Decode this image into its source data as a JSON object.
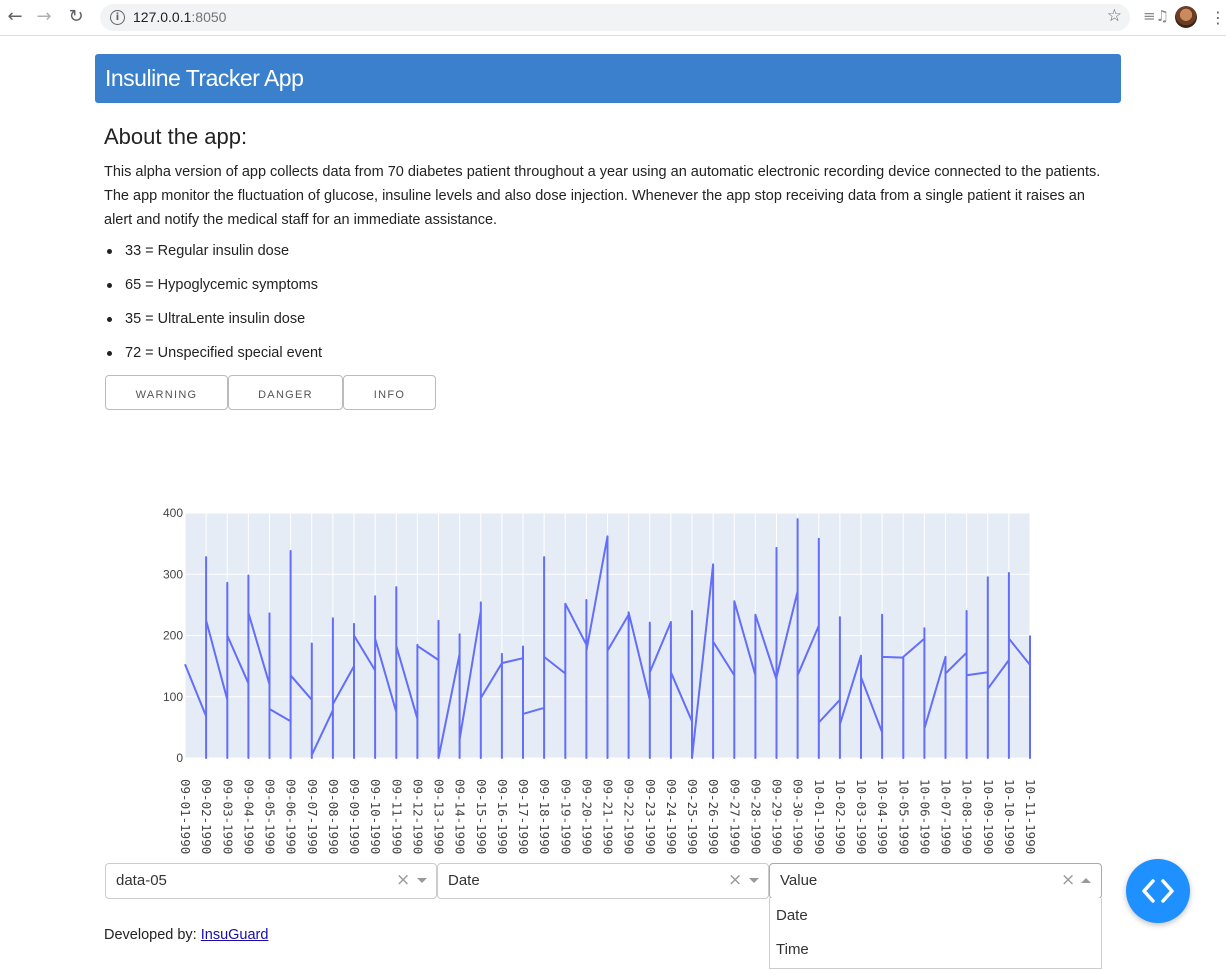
{
  "browser": {
    "url_host": "127.0.0.1",
    "url_port": ":8050"
  },
  "header": {
    "title": "Insuline Tracker App"
  },
  "about": {
    "title": "About the app:",
    "description": "This alpha version of app collects data from 70 diabetes patient throughout a year using an automatic electronic recording device connected to the patients. The app monitor the fluctuation of glucose, insuline levels and also dose injection. Whenever the app stop receiving data from a single patient it raises an alert and notify the medical staff for an immediate assistance.",
    "codes": [
      "33 = Regular insulin dose",
      "65 = Hypoglycemic symptoms",
      "35 = UltraLente insulin dose",
      "72 = Unspecified special event"
    ]
  },
  "buttons": {
    "warning": "WARNING",
    "danger": "DANGER",
    "info": "INFO"
  },
  "colors": {
    "header": "#3a80cc",
    "line": "#636efa",
    "plot_bg": "#e5ecf6",
    "fab": "#1e90ff"
  },
  "chart_data": {
    "type": "line",
    "ylim": [
      0,
      400
    ],
    "yticks": [
      0,
      100,
      200,
      300,
      400
    ],
    "xticks": [
      "09-01-1990",
      "09-02-1990",
      "09-03-1990",
      "09-04-1990",
      "09-05-1990",
      "09-06-1990",
      "09-07-1990",
      "09-08-1990",
      "09-09-1990",
      "09-10-1990",
      "09-11-1990",
      "09-12-1990",
      "09-13-1990",
      "09-14-1990",
      "09-15-1990",
      "09-16-1990",
      "09-17-1990",
      "09-18-1990",
      "09-19-1990",
      "09-20-1990",
      "09-21-1990",
      "09-22-1990",
      "09-23-1990",
      "09-24-1990",
      "09-25-1990",
      "09-26-1990",
      "09-27-1990",
      "09-28-1990",
      "09-29-1990",
      "09-30-1990",
      "10-01-1990",
      "10-02-1990",
      "10-03-1990",
      "10-04-1990",
      "10-05-1990",
      "10-06-1990",
      "10-07-1990",
      "10-08-1990",
      "10-09-1990",
      "10-10-1990",
      "10-11-1990"
    ],
    "series": [
      {
        "values": [
          [
            0,
            153
          ],
          [
            1,
            68
          ],
          [
            1,
            0
          ],
          [
            1,
            328
          ],
          [
            1,
            225
          ],
          [
            2,
            95
          ],
          [
            2,
            0
          ],
          [
            2,
            286
          ],
          [
            2,
            200
          ],
          [
            3,
            122
          ],
          [
            3,
            0
          ],
          [
            3,
            298
          ],
          [
            3,
            237
          ],
          [
            4,
            120
          ],
          [
            4,
            0
          ],
          [
            4,
            236
          ],
          [
            4,
            80
          ],
          [
            5,
            60
          ],
          [
            5,
            0
          ],
          [
            5,
            338
          ],
          [
            5,
            135
          ],
          [
            6,
            95
          ],
          [
            6,
            0
          ],
          [
            6,
            187
          ],
          [
            6,
            5
          ],
          [
            7,
            78
          ],
          [
            7,
            0
          ],
          [
            7,
            228
          ],
          [
            7,
            88
          ],
          [
            8,
            150
          ],
          [
            8,
            0
          ],
          [
            8,
            219
          ],
          [
            8,
            200
          ],
          [
            9,
            143
          ],
          [
            9,
            0
          ],
          [
            9,
            264
          ],
          [
            9,
            195
          ],
          [
            10,
            75
          ],
          [
            10,
            0
          ],
          [
            10,
            279
          ],
          [
            10,
            183
          ],
          [
            11,
            64
          ],
          [
            11,
            0
          ],
          [
            11,
            185
          ],
          [
            11,
            183
          ],
          [
            12,
            160
          ],
          [
            12,
            0
          ],
          [
            12,
            224
          ],
          [
            12,
            0
          ],
          [
            13,
            170
          ],
          [
            13,
            0
          ],
          [
            13,
            202
          ],
          [
            13,
            30
          ],
          [
            14,
            240
          ],
          [
            14,
            0
          ],
          [
            14,
            254
          ],
          [
            14,
            98
          ],
          [
            15,
            155
          ],
          [
            15,
            0
          ],
          [
            15,
            170
          ],
          [
            15,
            155
          ],
          [
            16,
            163
          ],
          [
            16,
            0
          ],
          [
            16,
            182
          ],
          [
            16,
            72
          ],
          [
            17,
            82
          ],
          [
            17,
            0
          ],
          [
            17,
            328
          ],
          [
            17,
            165
          ],
          [
            18,
            138
          ],
          [
            18,
            0
          ],
          [
            18,
            252
          ],
          [
            18,
            252
          ],
          [
            19,
            185
          ],
          [
            19,
            0
          ],
          [
            19,
            258
          ],
          [
            19,
            175
          ],
          [
            20,
            362
          ],
          [
            20,
            0
          ],
          [
            20,
            175
          ],
          [
            21,
            234
          ],
          [
            21,
            0
          ],
          [
            21,
            238
          ],
          [
            21,
            238
          ],
          [
            22,
            95
          ],
          [
            22,
            0
          ],
          [
            22,
            221
          ],
          [
            22,
            140
          ],
          [
            23,
            222
          ],
          [
            23,
            0
          ],
          [
            23,
            222
          ],
          [
            23,
            140
          ],
          [
            24,
            60
          ],
          [
            24,
            0
          ],
          [
            24,
            240
          ],
          [
            24,
            0
          ],
          [
            25,
            316
          ],
          [
            25,
            0
          ],
          [
            25,
            190
          ],
          [
            26,
            135
          ],
          [
            26,
            0
          ],
          [
            26,
            256
          ],
          [
            26,
            256
          ],
          [
            27,
            135
          ],
          [
            27,
            0
          ],
          [
            27,
            234
          ],
          [
            27,
            234
          ],
          [
            28,
            128
          ],
          [
            28,
            0
          ],
          [
            28,
            343
          ],
          [
            28,
            132
          ],
          [
            29,
            272
          ],
          [
            29,
            0
          ],
          [
            29,
            390
          ],
          [
            29,
            135
          ],
          [
            30,
            216
          ],
          [
            30,
            0
          ],
          [
            30,
            358
          ],
          [
            30,
            58
          ],
          [
            31,
            95
          ],
          [
            31,
            0
          ],
          [
            31,
            230
          ],
          [
            31,
            55
          ],
          [
            32,
            167
          ],
          [
            32,
            0
          ],
          [
            32,
            167
          ],
          [
            32,
            132
          ],
          [
            33,
            42
          ],
          [
            33,
            0
          ],
          [
            33,
            234
          ],
          [
            33,
            165
          ],
          [
            34,
            164
          ],
          [
            34,
            0
          ],
          [
            34,
            164
          ],
          [
            34,
            165
          ],
          [
            35,
            195
          ],
          [
            35,
            0
          ],
          [
            35,
            212
          ],
          [
            35,
            48
          ],
          [
            36,
            165
          ],
          [
            36,
            0
          ],
          [
            36,
            165
          ],
          [
            36,
            138
          ],
          [
            37,
            172
          ],
          [
            37,
            0
          ],
          [
            37,
            240
          ],
          [
            37,
            135
          ],
          [
            38,
            140
          ],
          [
            38,
            0
          ],
          [
            38,
            295
          ],
          [
            38,
            113
          ],
          [
            39,
            160
          ],
          [
            39,
            0
          ],
          [
            39,
            302
          ],
          [
            39,
            195
          ],
          [
            40,
            152
          ],
          [
            40,
            0
          ],
          [
            40,
            200
          ]
        ]
      }
    ]
  },
  "dropdowns": {
    "dataset": {
      "value": "data-05"
    },
    "x_axis": {
      "value": "Date"
    },
    "y_axis": {
      "value": "Value",
      "options": [
        "Date",
        "Time"
      ]
    }
  },
  "footer": {
    "label": "Developed by: ",
    "link": "InsuGuard"
  }
}
